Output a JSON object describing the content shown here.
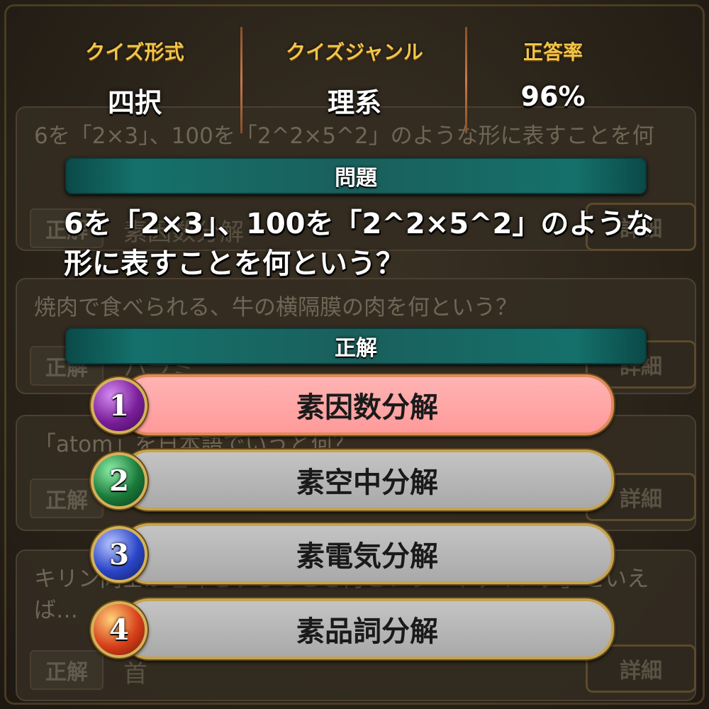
{
  "header": {
    "format_label": "クイズ形式",
    "format_value": "四択",
    "genre_label": "クイズジャンル",
    "genre_value": "理系",
    "rate_label": "正答率",
    "rate_value": "96%"
  },
  "background_list": {
    "item1_text": "6を「2×3」、100を「2^2×5^2」のような形に表すことを何",
    "item1_answer": "素因数分解",
    "item2_text": "焼肉で食べられる、牛の横隔膜の肉を何という？",
    "item2_answer": "ハラミ",
    "item3_text": "「atom」を日本語でいうと何？",
    "item4_text": "キリン同士が喧嘩をすることを何という「ネッキング」といえば…",
    "item4_answer": "首",
    "badge_label": "正解",
    "detail_label": "詳細"
  },
  "question_banner": "問題",
  "question_text": "6を「2×3」、100を「2^2×5^2」のような形に表すことを何という？",
  "answer_banner": "正解",
  "choices": [
    {
      "number": "1",
      "label": "素因数分解",
      "correct": true,
      "orb_color": "#7a1f9a"
    },
    {
      "number": "2",
      "label": "素空中分解",
      "correct": false,
      "orb_color": "#1a7a3a"
    },
    {
      "number": "3",
      "label": "素電気分解",
      "correct": false,
      "orb_color": "#2a46c8"
    },
    {
      "number": "4",
      "label": "素品詞分解",
      "correct": false,
      "orb_color": "#d8401a"
    }
  ]
}
